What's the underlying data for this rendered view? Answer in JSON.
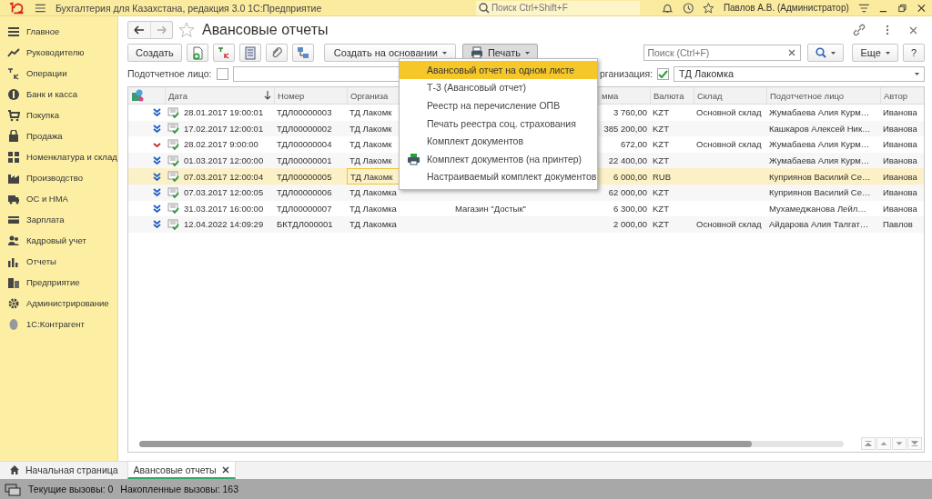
{
  "app": {
    "title": "Бухгалтерия для Казахстана, редакция 3.0 1С:Предприятие",
    "search": {
      "placeholder": "Поиск Ctrl+Shift+F"
    },
    "user": "Павлов А.В. (Администратор)"
  },
  "sidebar": {
    "items": [
      {
        "label": "Главное"
      },
      {
        "label": "Руководителю"
      },
      {
        "label": "Операции"
      },
      {
        "label": "Банк и касса"
      },
      {
        "label": "Покупка"
      },
      {
        "label": "Продажа"
      },
      {
        "label": "Номенклатура и склад"
      },
      {
        "label": "Производство"
      },
      {
        "label": "ОС и НМА"
      },
      {
        "label": "Зарплата"
      },
      {
        "label": "Кадровый учет"
      },
      {
        "label": "Отчеты"
      },
      {
        "label": "Предприятие"
      },
      {
        "label": "Администрирование"
      },
      {
        "label": "1С:Контрагент"
      }
    ]
  },
  "form": {
    "title": "Авансовые отчеты",
    "favorite": false,
    "toolbar": [
      {
        "kind": "button",
        "label": "Создать",
        "pressed": false
      },
      {
        "kind": "add",
        "pressed": false
      },
      {
        "kind": "posting",
        "pressed": false
      },
      {
        "kind": "list",
        "pressed": false
      },
      {
        "kind": "attach",
        "pressed": false
      },
      {
        "kind": "structure",
        "pressed": false
      },
      {
        "kind": "dropdown",
        "label": "Создать на основании",
        "pressed": false
      },
      {
        "kind": "print",
        "label": "Печать",
        "pressed": true
      }
    ],
    "search": {
      "placeholder": "Поиск (Ctrl+F)"
    },
    "more_button": "Еще",
    "help_button": "?",
    "filters": [
      {
        "label": "Подотчетное лицо:",
        "checked": false
      },
      {
        "label": "рганизация:",
        "checked": true,
        "value": "ТД Лакомка"
      }
    ],
    "print_menu": [
      {
        "kind": "text",
        "label": "Авансовый отчет на одном листе",
        "selected": true
      },
      {
        "kind": "text",
        "label": "Т-3 (Авансовый отчет)",
        "selected": false
      },
      {
        "kind": "text",
        "label": "Реестр на перечисление ОПВ",
        "selected": false
      },
      {
        "kind": "text",
        "label": "Печать реестра соц. страхования",
        "selected": false
      },
      {
        "kind": "text",
        "label": "Комплект документов",
        "selected": false
      },
      {
        "kind": "printer",
        "label": "Комплект документов (на принтер)",
        "selected": false
      },
      {
        "kind": "text",
        "label": "Настраиваемый комплект документов",
        "selected": false
      }
    ],
    "table": {
      "columns": [
        {
          "label": "Дата",
          "sorted": true
        },
        {
          "label": "Номер",
          "sorted": false
        },
        {
          "label": "Организа"
        },
        {},
        {
          "label": "мма",
          "sorted": false
        },
        {
          "label": "Валюта",
          "sorted": false
        },
        {
          "label": "Склад",
          "sorted": false
        },
        {
          "label": "Подотчетное лицо",
          "sorted": false
        },
        {
          "label": "Автор",
          "sorted": false
        }
      ],
      "rows": [
        {
          "posted": true,
          "selected": false,
          "cells": [
            "28.01.2017 19:00:01",
            "ТДЛ00000003",
            "ТД Лакомк",
            "",
            "3 760,00",
            "KZT",
            "Основной склад",
            "Жумабаева Алия Курм…",
            "Иванова"
          ]
        },
        {
          "posted": true,
          "selected": false,
          "cells": [
            "17.02.2017 12:00:01",
            "ТДЛ00000002",
            "ТД Лакомк",
            "",
            "385 200,00",
            "KZT",
            "",
            "Кашкаров Алексей Ник…",
            "Иванова"
          ]
        },
        {
          "posted": false,
          "selected": false,
          "cells": [
            "28.02.2017 9:00:00",
            "ТДЛ00000004",
            "ТД Лакомк",
            "",
            "672,00",
            "KZT",
            "Основной склад",
            "Жумабаева Алия Курм…",
            "Иванова"
          ]
        },
        {
          "posted": true,
          "selected": false,
          "cells": [
            "01.03.2017 12:00:00",
            "ТДЛ00000001",
            "ТД Лакомк",
            "",
            "22 400,00",
            "KZT",
            "",
            "Жумабаева Алия Курм…",
            "Иванова"
          ]
        },
        {
          "posted": true,
          "selected": true,
          "cells": [
            "07.03.2017 12:00:04",
            "ТДЛ00000005",
            "ТД Лакомк",
            "",
            "6 000,00",
            "RUB",
            "",
            "Куприянов Василий Се…",
            "Иванова"
          ]
        },
        {
          "posted": true,
          "selected": false,
          "cells": [
            "07.03.2017 12:00:05",
            "ТДЛ00000006",
            "ТД Лакомка",
            "",
            "62 000,00",
            "KZT",
            "",
            "Куприянов Василий Се…",
            "Иванова"
          ]
        },
        {
          "posted": true,
          "selected": false,
          "cells": [
            "31.03.2017 16:00:00",
            "ТДЛ00000007",
            "ТД Лакомка",
            "Магазин \"Достык\"",
            "6 300,00",
            "KZT",
            "",
            "Мухамеджанова Лейл…",
            "Иванова"
          ]
        },
        {
          "posted": true,
          "selected": false,
          "cells": [
            "12.04.2022 14:09:29",
            "БКТДЛ000001",
            "ТД Лакомка",
            "",
            "2 000,00",
            "KZT",
            "Основной склад",
            "Айдарова Алия Талгат…",
            "Павлов"
          ]
        }
      ]
    }
  },
  "tabs": [
    {
      "kind": "home",
      "label": "Начальная страница",
      "selected": false
    },
    {
      "kind": "closable",
      "label": "Авансовые отчеты",
      "selected": true
    }
  ],
  "status_bar": {
    "items": [
      "Текущие вызовы: 0",
      "Накопленные вызовы: 163"
    ]
  }
}
